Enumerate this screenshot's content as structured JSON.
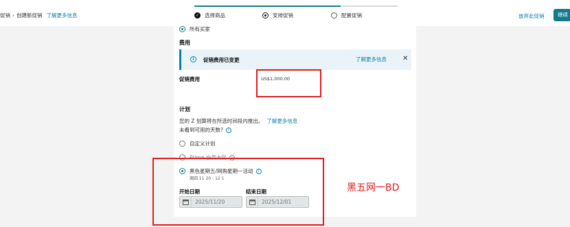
{
  "header": {
    "breadcrumb_current": "促销",
    "breadcrumb_sep": "›",
    "breadcrumb_page": "创建新促销",
    "learn_more": "了解更多信息",
    "steps": [
      {
        "label": "选择商品",
        "state": "done"
      },
      {
        "label": "安排促销",
        "state": "active"
      },
      {
        "label": "配置促销",
        "state": "todo"
      }
    ],
    "progress_fraction": 0.72,
    "abandon_label": "放弃此促销",
    "continue_label": "继续"
  },
  "form": {
    "audience_option": "所有买家",
    "fee_heading": "费用",
    "alert": {
      "text": "促销费用已变更",
      "link": "了解更多信息",
      "close_glyph": "✕",
      "info_glyph": "i"
    },
    "fee_label": "促销费用",
    "fee_value": "US$1,000.00",
    "schedule_heading": "计划",
    "schedule_desc": "您的 Z 划算将在所选时间段内推出。",
    "schedule_link": "了解更多信息",
    "days_question": "未看到可用的天数?",
    "options": {
      "custom": "自定义计划",
      "prime": "Prime 会员大促",
      "bf": "黑色星期五/网购星期一活动",
      "bf_dates": "周四 11 20 - 12 1"
    },
    "start_label": "开始日期",
    "end_label": "结束日期",
    "start_date": "2025/11/20",
    "end_date": "2025/12/01"
  },
  "annotation": {
    "text": "黑五网一BD",
    "color": "#e21a1a"
  },
  "colors": {
    "accent": "#127a8c",
    "link": "#0a7ea8",
    "alert_bg": "#eaf4f8"
  }
}
